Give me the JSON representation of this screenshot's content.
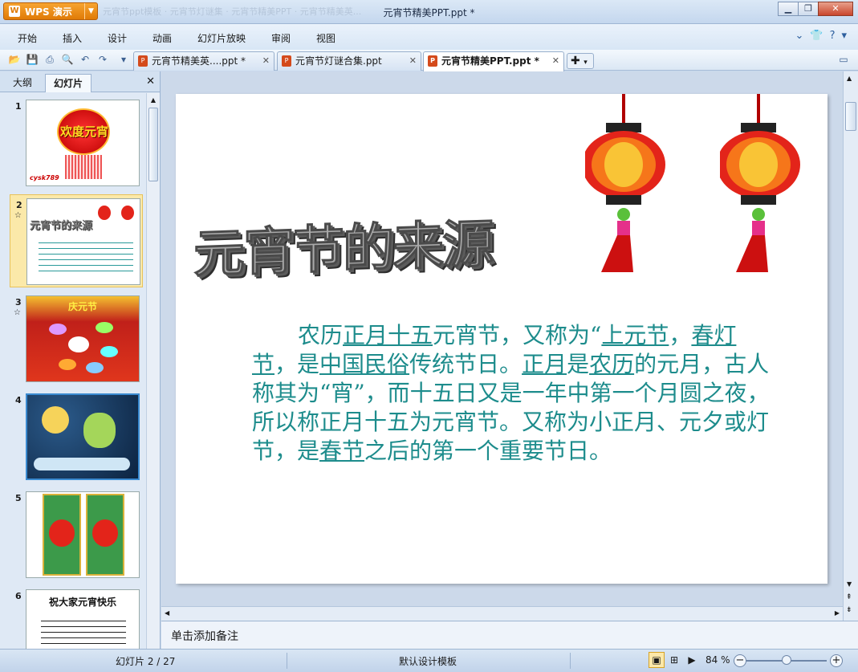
{
  "app": {
    "brand": "WPS 演示",
    "window_title": "元宵节精美PPT.ppt *",
    "ghost_tabs": "元宵节ppt模板  ·  元宵节灯谜集  ·  元宵节精美PPT  ·  元宵节精美英..."
  },
  "menu": [
    "开始",
    "插入",
    "设计",
    "动画",
    "幻灯片放映",
    "审阅",
    "视图"
  ],
  "doc_tabs": [
    {
      "label": "元宵节精美英....ppt *",
      "active": false
    },
    {
      "label": "元宵节灯谜合集.ppt",
      "active": false
    },
    {
      "label": "元宵节精美PPT.ppt *",
      "active": true
    }
  ],
  "left_panel": {
    "tabs": [
      "大纲",
      "幻灯片"
    ],
    "active_tab": "幻灯片",
    "thumbnails": [
      {
        "num": "1",
        "caption": "欢度元宵",
        "sub": "cysk789"
      },
      {
        "num": "2",
        "caption": "元宵节的来源",
        "selected": true
      },
      {
        "num": "3",
        "caption": "庆元节"
      },
      {
        "num": "4",
        "caption": ""
      },
      {
        "num": "5",
        "caption": ""
      },
      {
        "num": "6",
        "caption": "祝大家元宵快乐"
      }
    ]
  },
  "slide": {
    "title": "元宵节的来源",
    "body_parts": [
      {
        "t": "农历",
        "u": false
      },
      {
        "t": "正月十五",
        "u": true
      },
      {
        "t": "元宵节，又称为“",
        "u": false
      },
      {
        "t": "上元节",
        "u": true
      },
      {
        "t": "，",
        "u": false
      },
      {
        "t": "春灯节",
        "u": true
      },
      {
        "t": "，是",
        "u": false
      },
      {
        "t": "中国民俗",
        "u": true
      },
      {
        "t": "传统节日。",
        "u": false
      },
      {
        "t": "正月",
        "u": true
      },
      {
        "t": "是",
        "u": false
      },
      {
        "t": "农历",
        "u": true
      },
      {
        "t": "的元月，古人称其为“宵”，而十五日又是一年中第一个月圆之夜，所以称正月十五为元宵节。又称为小正月、元夕或灯节，是",
        "u": false
      },
      {
        "t": "春节",
        "u": true
      },
      {
        "t": "之后的第一个重要节日。",
        "u": false
      }
    ]
  },
  "notes_placeholder": "单击添加备注",
  "status": {
    "slide_counter": "幻灯片 2 / 27",
    "template": "默认设计模板",
    "zoom": "84 %",
    "zoom_fraction": 0.5
  },
  "colors": {
    "accent": "#e07b06",
    "body_text": "#1d8c8c",
    "lantern_red": "#e3241a"
  }
}
